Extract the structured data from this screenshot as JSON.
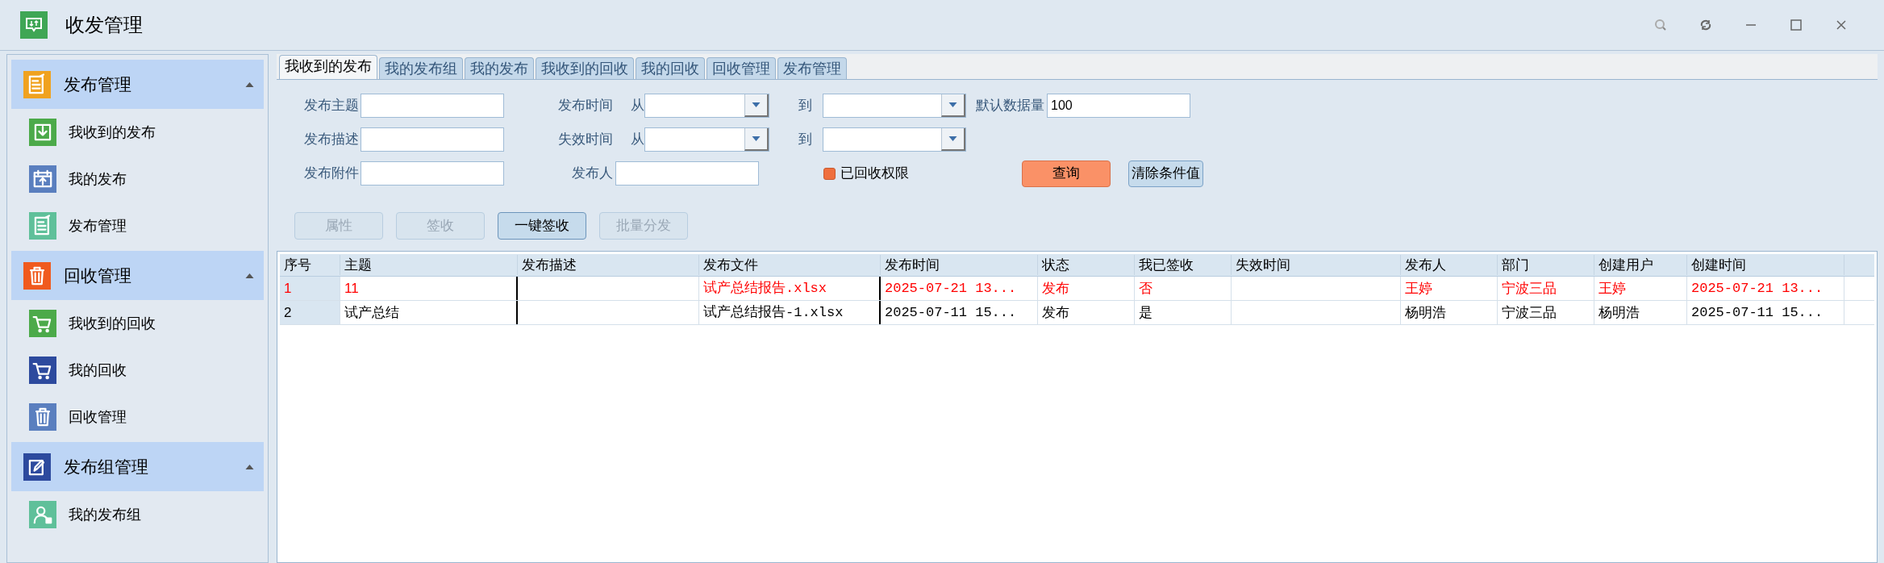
{
  "window": {
    "title": "收发管理"
  },
  "sidebar": {
    "groups": [
      {
        "title": "发布管理",
        "expanded": true,
        "kind": "note",
        "color": "#f0a21f",
        "items": [
          {
            "label": "我收到的发布",
            "kind": "download",
            "color": "#4caa4a"
          },
          {
            "label": "我的发布",
            "kind": "calendar",
            "color": "#5a7fbf"
          },
          {
            "label": "发布管理",
            "kind": "note",
            "color": "#5fc09a"
          }
        ]
      },
      {
        "title": "回收管理",
        "expanded": true,
        "kind": "trash",
        "color": "#f05a1e",
        "items": [
          {
            "label": "我收到的回收",
            "kind": "cart",
            "color": "#4caa4a"
          },
          {
            "label": "我的回收",
            "kind": "cart",
            "color": "#2d4a9e"
          },
          {
            "label": "回收管理",
            "kind": "trash",
            "color": "#5a7fbf"
          }
        ]
      },
      {
        "title": "发布组管理",
        "expanded": true,
        "kind": "edit",
        "color": "#2d4a9e",
        "items": [
          {
            "label": "我的发布组",
            "kind": "user",
            "color": "#5fc09a"
          }
        ]
      }
    ]
  },
  "tabs": [
    {
      "label": "我收到的发布",
      "selected": true
    },
    {
      "label": "我的发布组",
      "selected": false
    },
    {
      "label": "我的发布",
      "selected": false
    },
    {
      "label": "我收到的回收",
      "selected": false
    },
    {
      "label": "我的回收",
      "selected": false
    },
    {
      "label": "回收管理",
      "selected": false
    },
    {
      "label": "发布管理",
      "selected": false
    }
  ],
  "filters": {
    "subject": {
      "label": "发布主题"
    },
    "description": {
      "label": "发布描述"
    },
    "attachment": {
      "label": "发布附件"
    },
    "publish_time": {
      "label": "发布时间",
      "from": "从",
      "to": "到"
    },
    "expire_time": {
      "label": "失效时间",
      "from": "从",
      "to": "到"
    },
    "publisher": {
      "label": "发布人"
    },
    "default_count": {
      "label": "默认数据量",
      "value": "100"
    },
    "recalled": {
      "label": "已回收权限",
      "checked": false
    },
    "query_button": "查询",
    "clear_button": "清除条件值"
  },
  "actions": [
    {
      "label": "属性",
      "disabled": true
    },
    {
      "label": "签收",
      "disabled": true
    },
    {
      "label": "一键签收",
      "disabled": false
    },
    {
      "label": "批量分发",
      "disabled": true
    }
  ],
  "table": {
    "columns": [
      "序号",
      "主题",
      "发布描述",
      "发布文件",
      "发布时间",
      "状态",
      "我已签收",
      "失效时间",
      "发布人",
      "部门",
      "创建用户",
      "创建时间"
    ],
    "rows": [
      {
        "highlighted": true,
        "cells": [
          "1",
          "11",
          "",
          "试产总结报告.xlsx",
          "2025-07-21 13...",
          "发布",
          "否",
          "",
          "王婷",
          "宁波三品",
          "王婷",
          "2025-07-21 13..."
        ]
      },
      {
        "highlighted": false,
        "cells": [
          "2",
          "试产总结",
          "",
          "试产总结报告-1.xlsx",
          "2025-07-11 15...",
          "发布",
          "是",
          "",
          "杨明浩",
          "宁波三品",
          "杨明浩",
          "2025-07-11 15..."
        ]
      }
    ]
  }
}
